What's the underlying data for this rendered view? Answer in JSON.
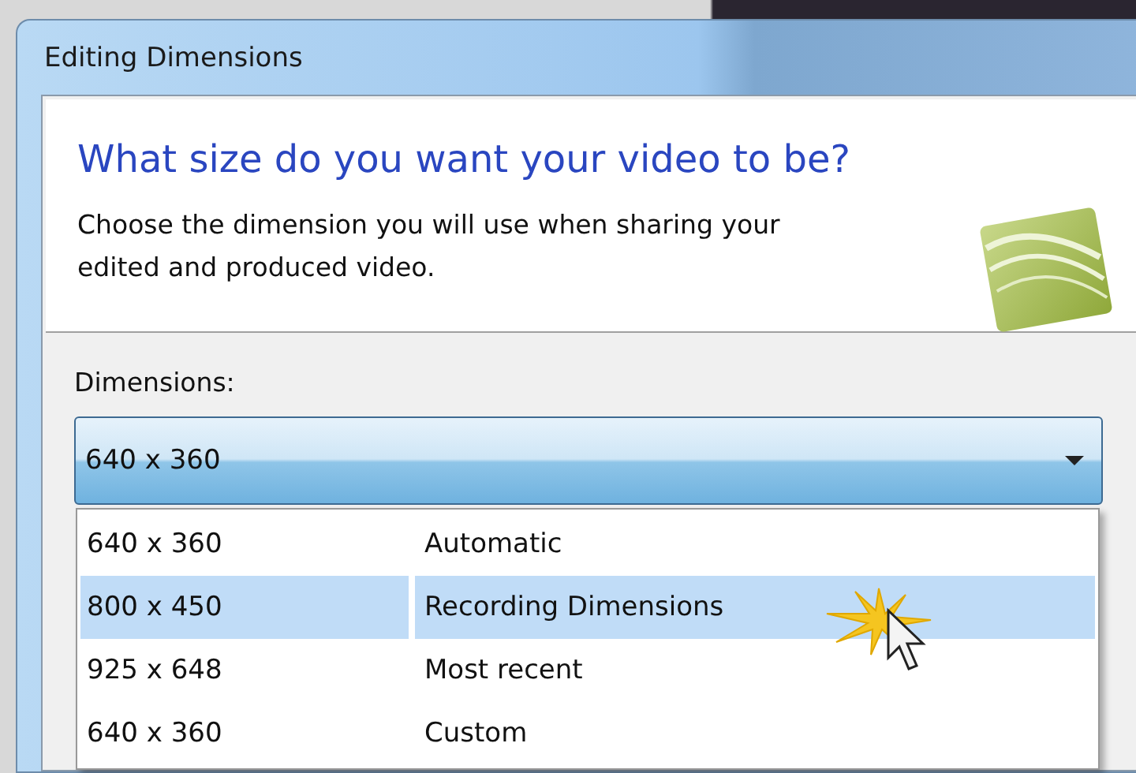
{
  "window": {
    "title": "Editing Dimensions"
  },
  "header": {
    "heading": "What size do you want your video to be?",
    "description": "Choose the dimension you will use when sharing your edited and produced video."
  },
  "dimensions": {
    "label": "Dimensions:",
    "value": "640 x 360",
    "expanded": true,
    "options": [
      {
        "size": "640 x 360",
        "name": "Automatic",
        "highlighted": false
      },
      {
        "size": "800 x 450",
        "name": "Recording Dimensions",
        "highlighted": true
      },
      {
        "size": "925 x 648",
        "name": "Most recent",
        "highlighted": false
      },
      {
        "size": "640 x 360",
        "name": "Custom",
        "highlighted": false
      }
    ]
  }
}
